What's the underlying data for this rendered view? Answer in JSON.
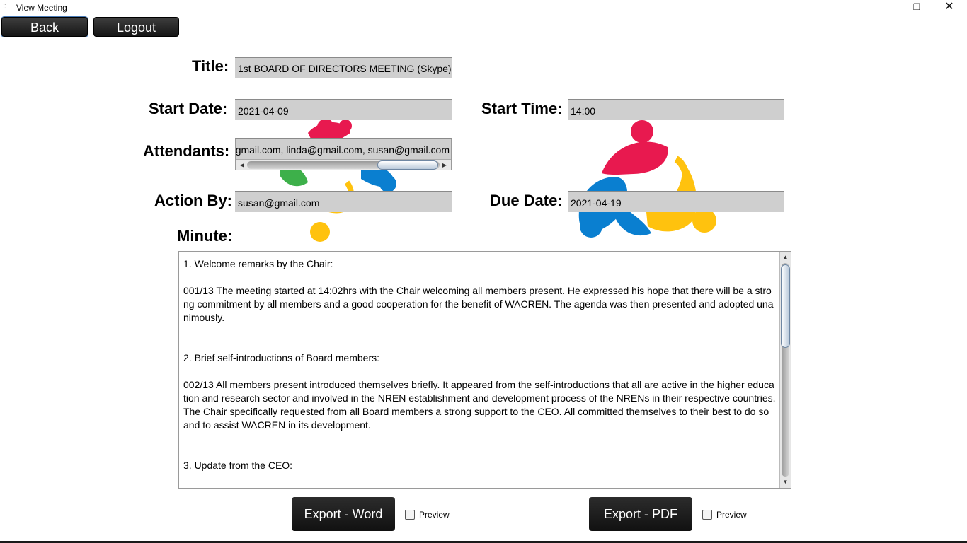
{
  "window": {
    "title": "View Meeting",
    "icon": "app-icon",
    "controls": {
      "minimize": "—",
      "maximize": "❐",
      "close": "✕"
    }
  },
  "toolbar": {
    "back_label": "Back",
    "logout_label": "Logout"
  },
  "form": {
    "title_label": "Title:",
    "title_value": "1st BOARD OF DIRECTORS MEETING (Skype)",
    "start_date_label": "Start Date:",
    "start_date_value": "2021-04-09",
    "start_time_label": "Start Time:",
    "start_time_value": "14:00",
    "attendants_label": "Attendants:",
    "attendants_value": "gmail.com, linda@gmail.com, susan@gmail.com",
    "action_by_label": "Action By:",
    "action_by_value": "susan@gmail.com",
    "due_date_label": "Due Date:",
    "due_date_value": "2021-04-19",
    "minute_label": "Minute:"
  },
  "minute": {
    "paragraphs": [
      "1. Welcome remarks by the Chair:",
      "001/13 The meeting started at 14:02hrs with the Chair welcoming all members present. He expressed his hope that there will be a strong commitment by all members and a good cooperation for the benefit of WACREN. The agenda was then presented and adopted unanimously.",
      "2. Brief self-introductions of Board members:",
      "002/13 All members present introduced themselves briefly. It appeared from the self-introductions that all are active in the higher education and research sector and involved in the NREN establishment and development process of the NRENs in their respective countries. The Chair specifically requested from all Board members a strong support to the CEO. All committed themselves to their best to do so and to assist WACREN in its development.",
      "3. Update from the CEO:"
    ]
  },
  "export": {
    "word_label": "Export - Word",
    "pdf_label": "Export - PDF",
    "word_preview_label": "Preview",
    "pdf_preview_label": "Preview",
    "word_preview_checked": false,
    "pdf_preview_checked": false
  },
  "colors": {
    "logo_red": "#e8194f",
    "logo_blue": "#0a7fd0",
    "logo_yellow": "#ffc20e",
    "logo_green": "#3db04a",
    "field_bg": "#cfcfcf",
    "button_dark": "#1a1a1a"
  }
}
